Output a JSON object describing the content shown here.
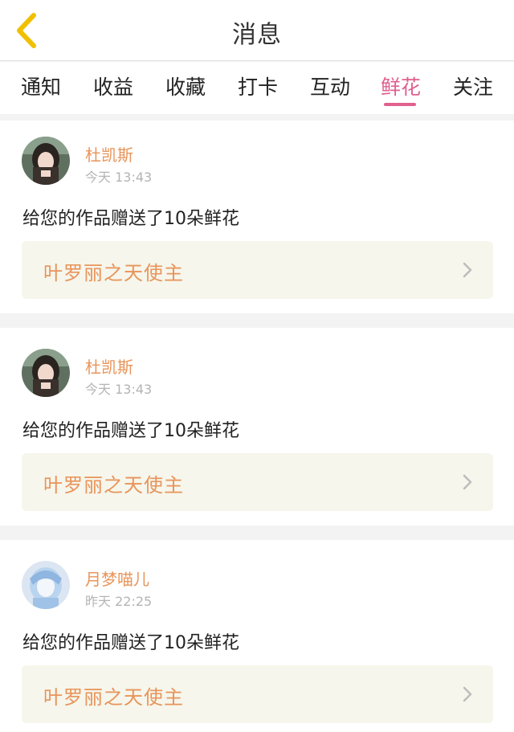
{
  "header": {
    "title": "消息",
    "back_icon": "chevron-left-icon"
  },
  "tabs": [
    {
      "label": "通知"
    },
    {
      "label": "收益"
    },
    {
      "label": "收藏"
    },
    {
      "label": "打卡"
    },
    {
      "label": "互动"
    },
    {
      "label": "鲜花",
      "active": true
    },
    {
      "label": "关注"
    }
  ],
  "messages": [
    {
      "name": "杜凯斯",
      "time": "今天 13:43",
      "text": "给您的作品赠送了10朵鲜花",
      "work": "叶罗丽之天使主"
    },
    {
      "name": "杜凯斯",
      "time": "今天 13:43",
      "text": "给您的作品赠送了10朵鲜花",
      "work": "叶罗丽之天使主"
    },
    {
      "name": "月梦喵儿",
      "time": "昨天 22:25",
      "text": "给您的作品赠送了10朵鲜花",
      "work": "叶罗丽之天使主"
    }
  ],
  "colors": {
    "accent_tab": "#e0608e",
    "name_orange": "#e8945a",
    "back_icon_yellow": "#f0c000",
    "work_box_bg": "#f6f6ec"
  }
}
